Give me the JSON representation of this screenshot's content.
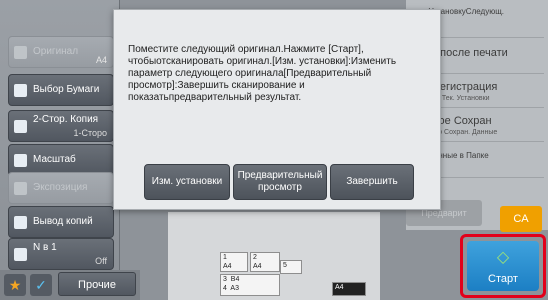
{
  "left_menu": [
    {
      "label": "Оригинал",
      "sub": "A4",
      "disabled": true
    },
    {
      "label": "Выбор Бумаги",
      "disabled": false
    },
    {
      "label": "2-Стор. Копия",
      "value": "1-Сторо",
      "disabled": false
    },
    {
      "label": "Масштаб",
      "disabled": false
    },
    {
      "label": "Экспозиция",
      "disabled": true
    },
    {
      "label": "Вывод копий",
      "disabled": false
    },
    {
      "label": "N в 1",
      "value": "Off",
      "disabled": false
    }
  ],
  "bottom_left": {
    "other_label": "Прочие"
  },
  "right_panel": {
    "items": [
      {
        "title": "ить УстановкуСледующ.",
        "sub": "нала"
      },
      {
        "title": "дать после печати",
        "sub": ""
      },
      {
        "title": "ам. регистрация",
        "sub": "ировать Тек. Установки"
      },
      {
        "title": "ыстрое Сохран",
        "sub": "ременно Сохран. Данные"
      },
      {
        "title": "ить Данные в Папке",
        "sub": ""
      }
    ],
    "preview_label": "Предварит",
    "ca_label": "CA",
    "start_label": "Старт"
  },
  "machine_trays": [
    {
      "num": "1",
      "size": "A4"
    },
    {
      "num": "2",
      "size": "A4"
    },
    {
      "num": "3",
      "size": "B4"
    },
    {
      "num": "4",
      "size": "A3"
    },
    {
      "num": "5",
      "size": ""
    },
    {
      "num": "",
      "size": "A4"
    }
  ],
  "dialog": {
    "message": "Поместите следующий оригинал.Нажмите [Старт], чтобыотсканировать оригинал.[Изм. установки]:Изменить параметр следующего оригинала[Предварительный просмотр]:Завершить сканирование и показатьпредварительный результат.",
    "btn_change": "Изм. установки",
    "btn_preview": "Предварительный просмотр",
    "btn_finish": "Завершить"
  },
  "colors": {
    "start": "#1c7fc4",
    "ca": "#f0a000",
    "highlight": "#e2001a"
  }
}
